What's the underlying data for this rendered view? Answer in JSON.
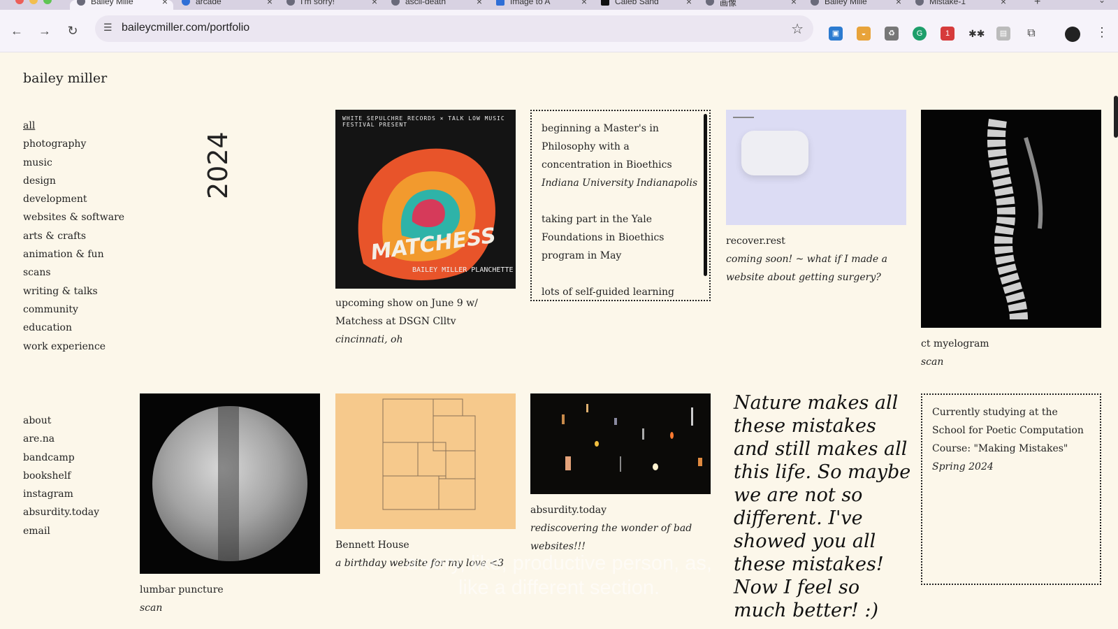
{
  "browser": {
    "tabs": [
      {
        "label": "Bailey Mille"
      },
      {
        "label": "arcade"
      },
      {
        "label": "I'm sorry!"
      },
      {
        "label": "ascii-death"
      },
      {
        "label": "Image to A"
      },
      {
        "label": "Caleb Sand"
      },
      {
        "label": "画像"
      },
      {
        "label": "Bailey Mille"
      },
      {
        "label": "Mistake-1"
      }
    ],
    "url": "baileycmiller.com/portfolio"
  },
  "site": {
    "title": "bailey miller",
    "nav": [
      "all",
      "photography",
      "music",
      "design",
      "development",
      "websites & software",
      "arts & crafts",
      "animation & fun",
      "scans",
      "writing & talks",
      "community",
      "education",
      "work experience"
    ],
    "links": [
      "about",
      "are.na",
      "bandcamp",
      "bookshelf",
      "instagram",
      "absurdity.today",
      "email"
    ],
    "year": "2024"
  },
  "cards": {
    "matchess": {
      "poster_header": "WHITE SEPULCHRE RECORDS × TALK LOW MUSIC FESTIVAL PRESENT",
      "poster_title": "MATCHESS",
      "poster_footer": "BAILEY MILLER  PLANCHETTE",
      "title": "upcoming show on June 9 w/ Matchess at DSGN Clltv",
      "subtitle": "cincinnati, oh"
    },
    "masters": {
      "line1": "beginning a Master's in Philosophy with a concentration in Bioethics",
      "line1_italic": "Indiana University Indianapolis",
      "line2": "taking part in the Yale Foundations in Bioethics program in May",
      "line3": "lots of self-guided learning along"
    },
    "recover": {
      "title": "recover.rest",
      "subtitle": "coming soon! ~ what if I made a website about getting surgery?"
    },
    "myelogram": {
      "title": "ct myelogram",
      "subtitle": "scan"
    },
    "lumbar": {
      "title": "lumbar puncture",
      "subtitle": "scan"
    },
    "bennett": {
      "title": "Bennett House",
      "subtitle": "a birthday website for my love <3"
    },
    "absurdity": {
      "title": "absurdity.today",
      "subtitle": "rediscovering the wonder of bad websites!!!"
    },
    "handwritten": {
      "text": "Nature makes all these mistakes and still makes all this life. So maybe we are not so different. I've showed you all these mistakes! Now I feel so much better! :)"
    },
    "sfpc": {
      "text": "Currently studying at the School for Poetic Computation Course: \"Making Mistakes\"",
      "italic": "Spring 2024"
    }
  },
  "subtitles": {
    "line1": "a very, like, productive person, as,",
    "line2": "like a different section."
  }
}
